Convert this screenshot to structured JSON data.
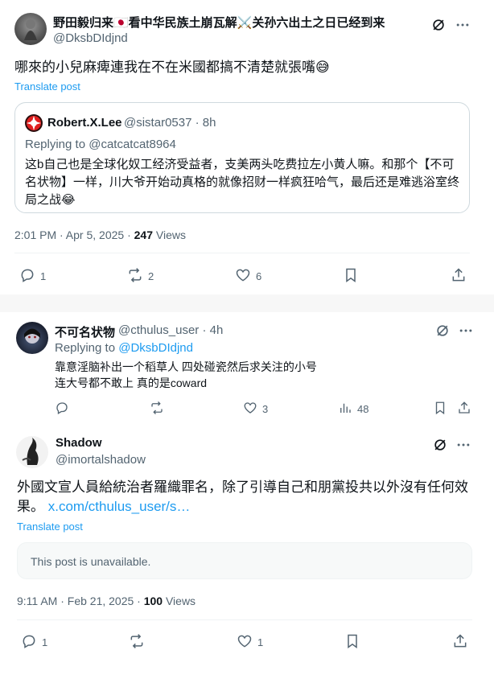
{
  "tweet1": {
    "display_name": "野田毅归来🇯🇵看中华民族土崩瓦解⚔️关孙六出土之日已经到来",
    "handle": "@DksbDIdjnd",
    "text": "哪來的小兒麻痺連我在不在米國都搞不清楚就張嘴😅",
    "translate": "Translate post",
    "quote": {
      "name": "Robert.X.Lee",
      "handle": "@sistar0537",
      "time": "8h",
      "replying_label": "Replying to",
      "replying_to": "@catcatcat8964",
      "text": "这b自己也是全球化奴工经济受益者，支美两头吃费拉左小黄人嘛。和那个【不可名状物】一样，川大爷开始动真格的就像招财一样疯狂哈气，最后还是难逃浴室终局之战😂"
    },
    "timestamp": "2:01 PM · Apr 5, 2025 · ",
    "views_count": "247",
    "views_label": " Views",
    "actions": {
      "reply": "1",
      "repost": "2",
      "like": "6"
    }
  },
  "tweet2": {
    "display_name": "不可名状物",
    "handle": "@cthulus_user",
    "time": "· 4h",
    "replying_label": "Replying to ",
    "replying_to": "@DksbDIdjnd",
    "line1": "靠意淫脑补出一个稻草人 四处碰瓷然后求关注的小号",
    "line2": "连大号都不敢上 真的是coward",
    "actions": {
      "reply": "",
      "repost": "",
      "like": "3",
      "views": "48"
    }
  },
  "tweet3": {
    "display_name": "Shadow",
    "handle": "@imortalshadow",
    "text": "外國文宣人員給統治者羅織罪名，除了引導自己和朋黨投共以外沒有任何效果。",
    "link": "x.com/cthulus_user/s…",
    "translate": "Translate post",
    "unavailable": "This post is unavailable.",
    "timestamp": "9:11 AM · Feb 21, 2025 · ",
    "views_count": "100",
    "views_label": " Views",
    "actions": {
      "reply": "1",
      "repost": "",
      "like": "1"
    }
  },
  "colors": {
    "accent": "#1d9bf0",
    "muted": "#536471",
    "text": "#0f1419",
    "border": "#cfd9de"
  },
  "icons": [
    "grok-icon",
    "more-icon",
    "reply-icon",
    "repost-icon",
    "like-icon",
    "bookmark-icon",
    "share-icon",
    "views-icon"
  ]
}
